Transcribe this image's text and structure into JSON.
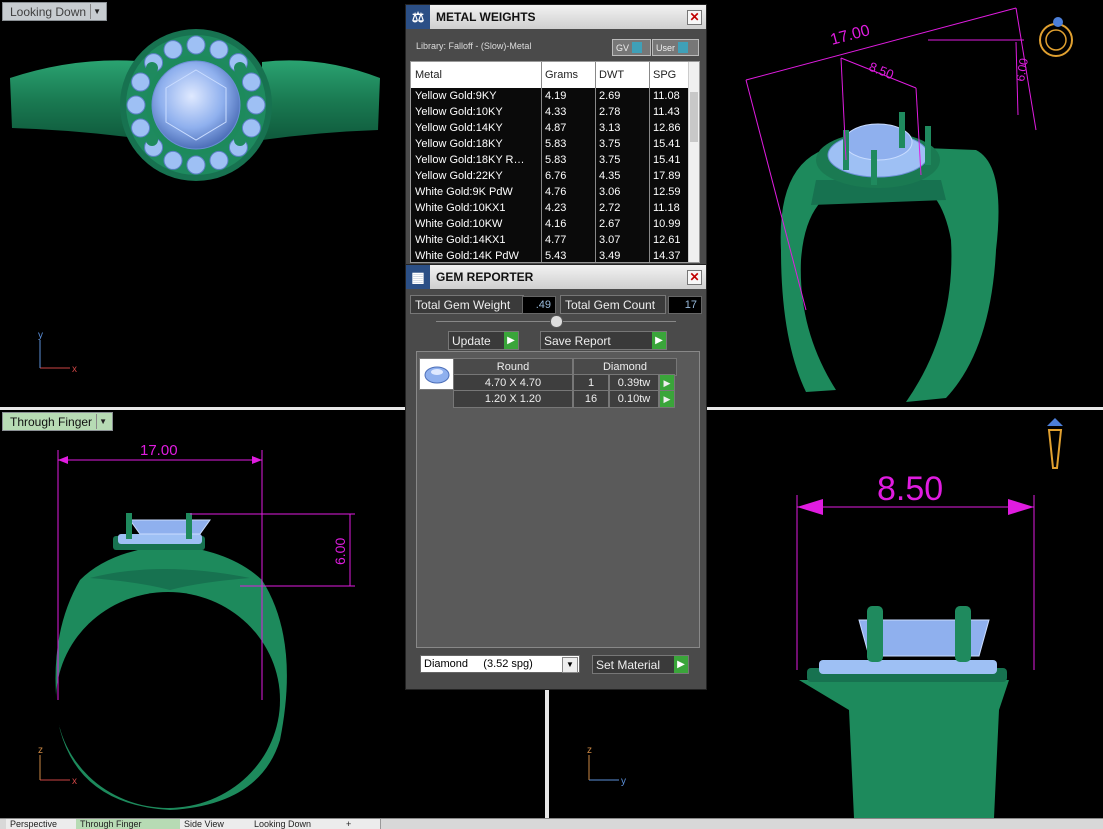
{
  "viewports": {
    "top_left": {
      "label": "Looking Down",
      "axes": {
        "v": "y",
        "h": "x"
      }
    },
    "bottom_left": {
      "label": "Through Finger",
      "dims": {
        "width": "17.00",
        "height": "6.00"
      },
      "axes": {
        "v": "z",
        "h": "x"
      }
    },
    "top_right": {
      "dims": {
        "width": "17.00",
        "depth": "8.50",
        "height": "6.00"
      }
    },
    "bottom_right": {
      "dims": {
        "width": "8.50"
      },
      "axes": {
        "v": "z",
        "h": "y"
      }
    }
  },
  "metal_weights": {
    "title": "METAL WEIGHTS",
    "library": "Library: Falloff - (Slow)-Metal",
    "toggle_gv": "GV",
    "toggle_user": "User",
    "columns": [
      "Metal",
      "Grams",
      "DWT",
      "SPG"
    ],
    "rows": [
      [
        "Yellow Gold:9KY",
        "4.19",
        "2.69",
        "11.08"
      ],
      [
        "Yellow Gold:10KY",
        "4.33",
        "2.78",
        "11.43"
      ],
      [
        "Yellow Gold:14KY",
        "4.87",
        "3.13",
        "12.86"
      ],
      [
        "Yellow Gold:18KY",
        "5.83",
        "3.75",
        "15.41"
      ],
      [
        "Yellow Gold:18KY R…",
        "5.83",
        "3.75",
        "15.41"
      ],
      [
        "Yellow Gold:22KY",
        "6.76",
        "4.35",
        "17.89"
      ],
      [
        "White Gold:9K PdW",
        "4.76",
        "3.06",
        "12.59"
      ],
      [
        "White Gold:10KX1",
        "4.23",
        "2.72",
        "11.18"
      ],
      [
        "White Gold:10KW",
        "4.16",
        "2.67",
        "10.99"
      ],
      [
        "White Gold:14KX1",
        "4.77",
        "3.07",
        "12.61"
      ],
      [
        "White Gold:14K PdW",
        "5.43",
        "3.49",
        "14.37"
      ]
    ]
  },
  "gem_reporter": {
    "title": "GEM REPORTER",
    "total_weight_label": "Total Gem Weight",
    "total_weight_value": ".49",
    "total_count_label": "Total Gem Count",
    "total_count_value": "17",
    "update_label": "Update",
    "save_report_label": "Save Report",
    "gem_headers": [
      "Round",
      "Diamond"
    ],
    "gems": [
      {
        "size": "4.70 X 4.70",
        "count": "1",
        "weight": "0.39tw"
      },
      {
        "size": "1.20 X 1.20",
        "count": "16",
        "weight": "0.10tw"
      }
    ],
    "material_select": "Diamond     (3.52 spg)",
    "set_material_label": "Set Material"
  },
  "bottom_tabs": [
    "Perspective",
    "Through Finger",
    "Side View",
    "Looking Down",
    "+"
  ],
  "colors": {
    "ring": "#1f8a5e",
    "gem": "#8fb4f0",
    "dimension": "#e01ce0",
    "active_label": "#b7dbb4"
  }
}
